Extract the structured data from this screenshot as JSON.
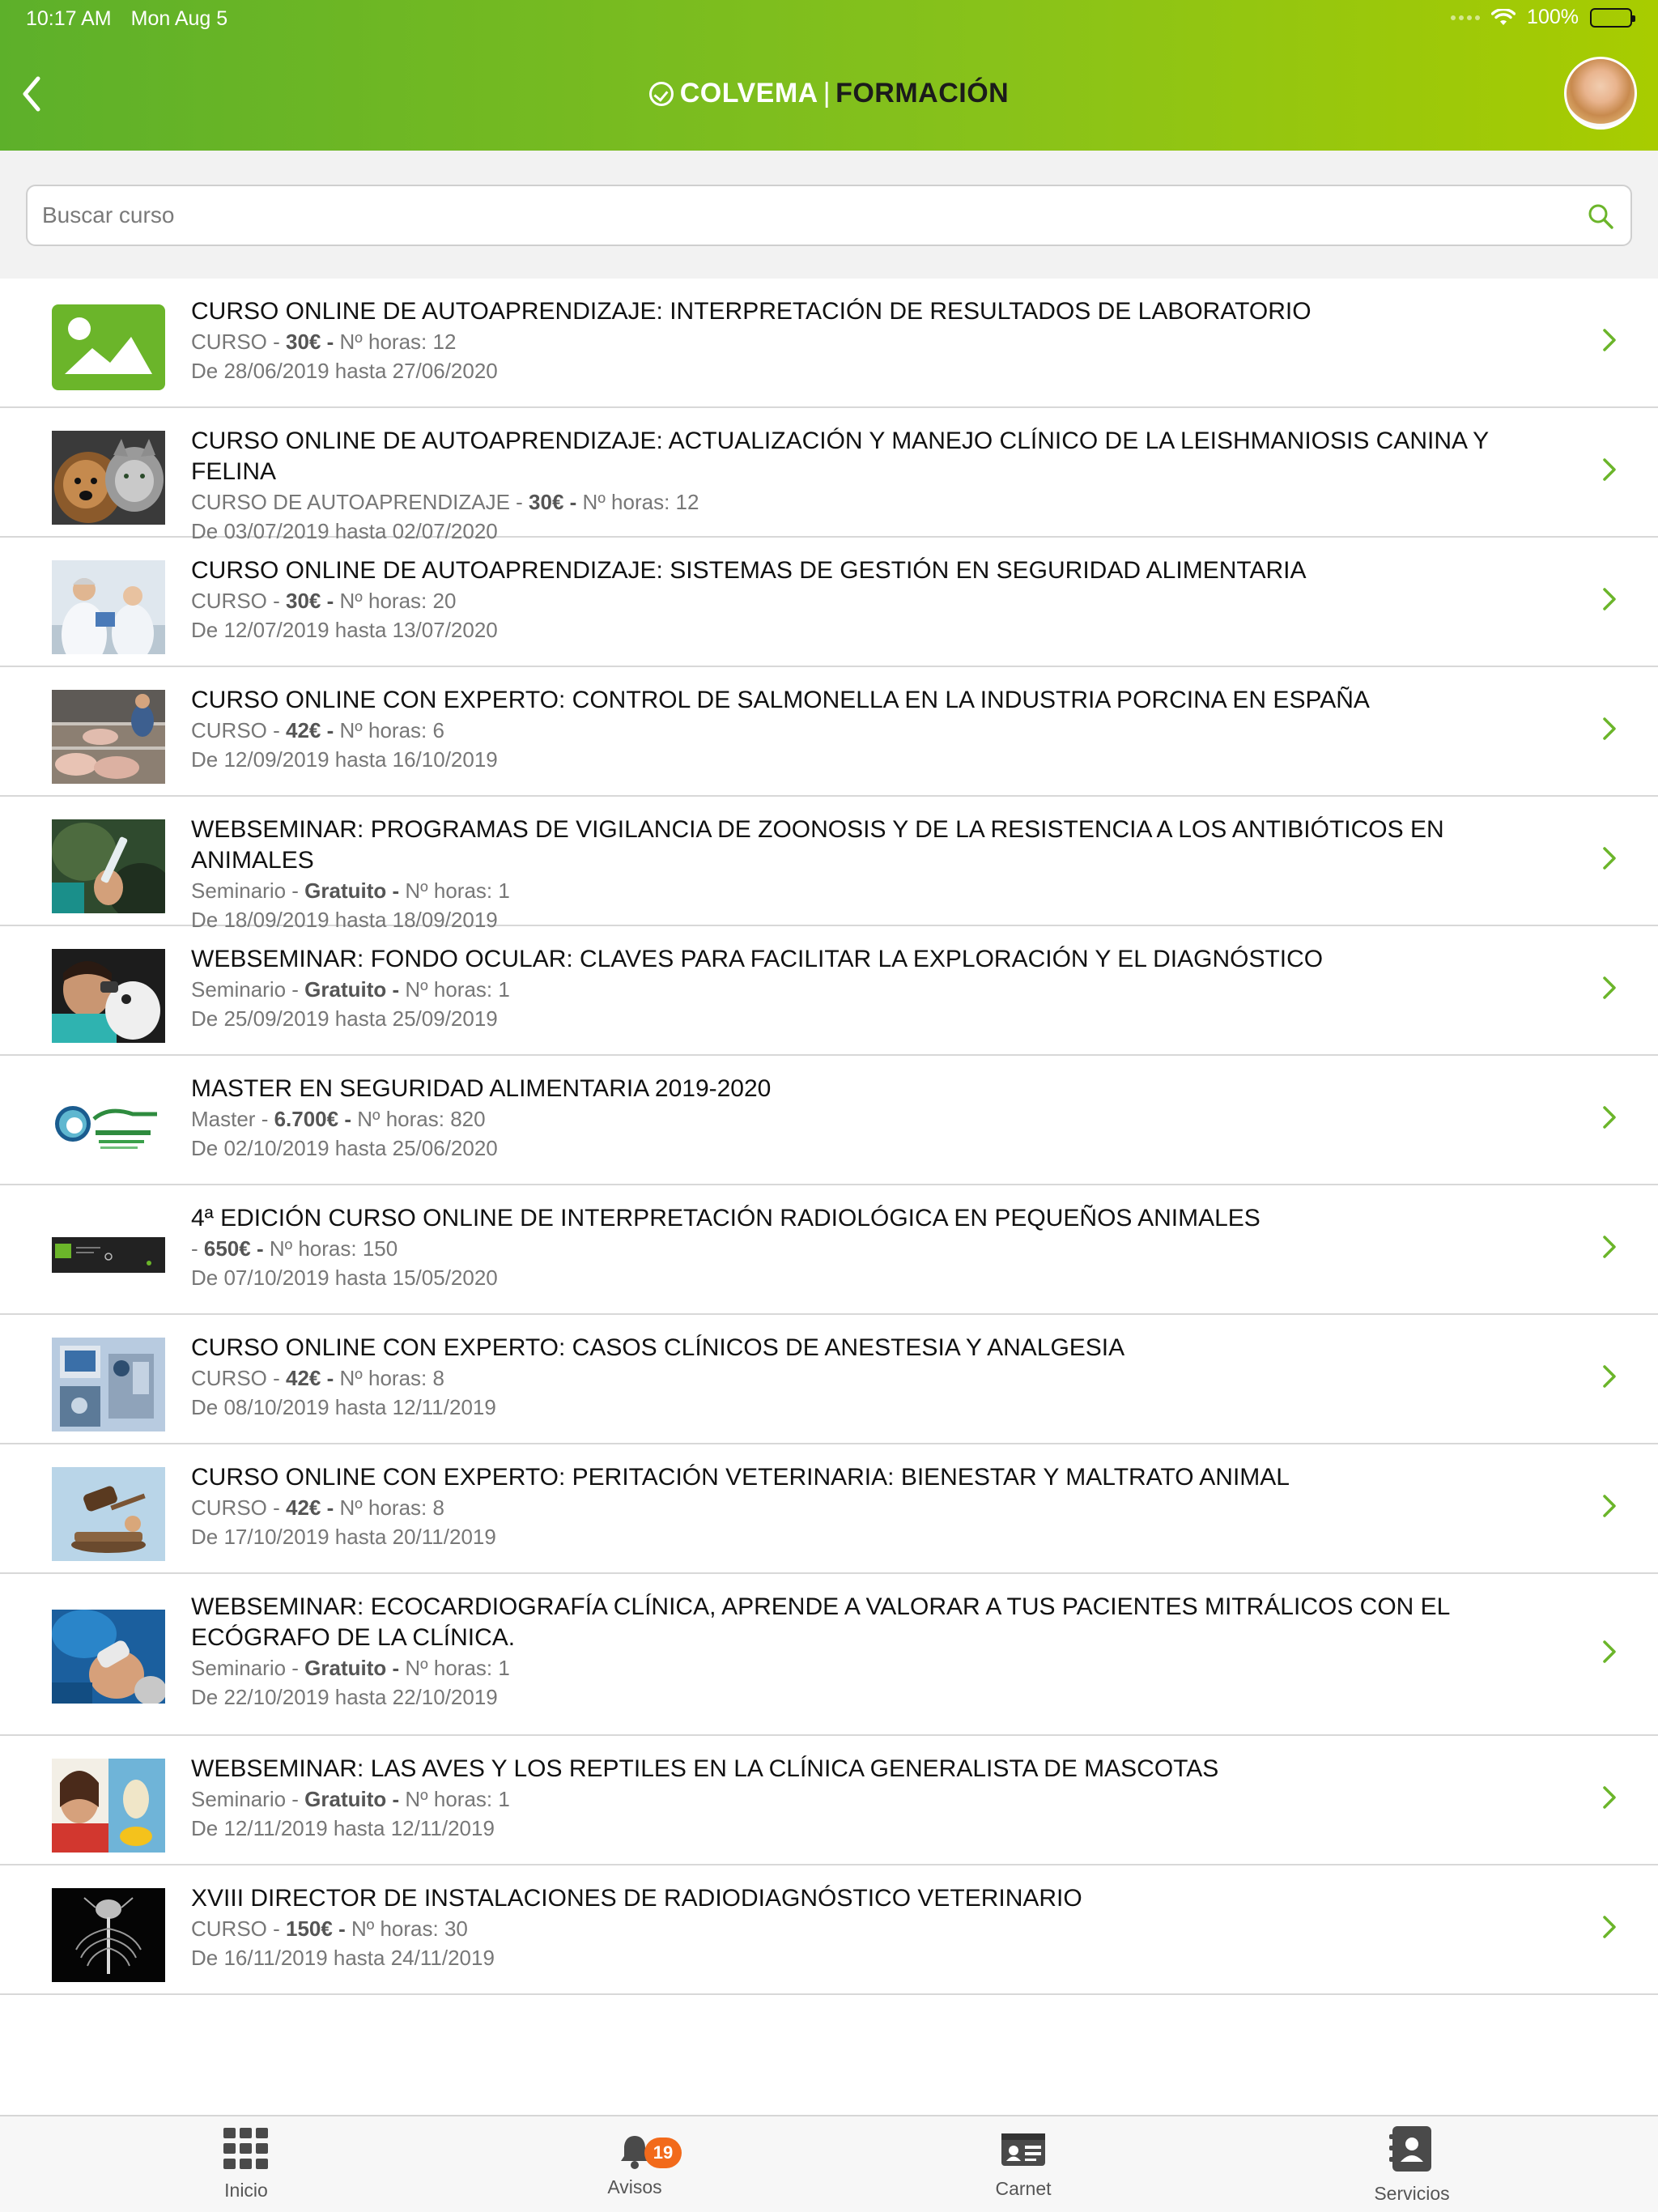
{
  "status_bar": {
    "time": "10:17 AM",
    "date": "Mon Aug 5",
    "battery": "100%"
  },
  "header": {
    "brand": "COLVEMA",
    "separator": "|",
    "subtitle": "FORMACIÓN",
    "brand_color": "#7cbb1f"
  },
  "search": {
    "placeholder": "Buscar curso",
    "value": ""
  },
  "courses": [
    {
      "title": "CURSO ONLINE DE AUTOAPRENDIZAJE: INTERPRETACIÓN DE RESULTADOS DE LABORATORIO",
      "type": "CURSO",
      "price": "30€",
      "hours_label": "Nº horas: 12",
      "dates": "De 28/06/2019 hasta 27/06/2020",
      "thumb": "placeholder-image-icon"
    },
    {
      "title": "CURSO ONLINE DE AUTOAPRENDIZAJE: ACTUALIZACIÓN Y MANEJO CLÍNICO DE LA LEISHMANIOSIS CANINA Y FELINA",
      "type": "CURSO DE AUTOAPRENDIZAJE",
      "price": "30€",
      "hours_label": "Nº horas: 12",
      "dates": "De 03/07/2019 hasta 02/07/2020",
      "thumb": "dog-and-cat-photo"
    },
    {
      "title": "CURSO ONLINE DE AUTOAPRENDIZAJE: SISTEMAS DE GESTIÓN EN SEGURIDAD ALIMENTARIA",
      "type": "CURSO",
      "price": "30€",
      "hours_label": "Nº horas: 20",
      "dates": "De 12/07/2019 hasta 13/07/2020",
      "thumb": "lab-workers-photo"
    },
    {
      "title": "CURSO ONLINE CON EXPERTO: CONTROL DE SALMONELLA EN LA INDUSTRIA PORCINA EN ESPAÑA",
      "type": "CURSO",
      "price": "42€",
      "hours_label": "Nº horas: 6",
      "dates": "De 12/09/2019 hasta 16/10/2019",
      "thumb": "pig-farm-photo"
    },
    {
      "title": "WEBSEMINAR: PROGRAMAS DE VIGILANCIA DE ZOONOSIS Y DE LA RESISTENCIA A LOS ANTIBIÓTICOS EN ANIMALES",
      "type": "Seminario",
      "price": "Gratuito",
      "hours_label": "Nº horas: 1",
      "dates": "De 18/09/2019 hasta 18/09/2019",
      "thumb": "syringe-photo"
    },
    {
      "title": "WEBSEMINAR: FONDO OCULAR: CLAVES PARA FACILITAR LA EXPLORACIÓN Y EL DIAGNÓSTICO",
      "type": "Seminario",
      "price": "Gratuito",
      "hours_label": "Nº horas: 1",
      "dates": "De 25/09/2019 hasta 25/09/2019",
      "thumb": "eye-exam-photo"
    },
    {
      "title": "MASTER EN SEGURIDAD ALIMENTARIA 2019-2020",
      "type": "Master",
      "price": "6.700€",
      "hours_label": "Nº horas: 820",
      "dates": "De 02/10/2019 hasta 25/06/2020",
      "thumb": "msa-logo"
    },
    {
      "title": "4ª EDICIÓN CURSO ONLINE DE INTERPRETACIÓN RADIOLÓGICA EN PEQUEÑOS ANIMALES",
      "type": "",
      "price": "650€",
      "hours_label": "Nº horas: 150",
      "dates": "De 07/10/2019 hasta 15/05/2020",
      "thumb": "radiology-banner"
    },
    {
      "title": "CURSO ONLINE CON EXPERTO: CASOS CLÍNICOS DE ANESTESIA Y ANALGESIA",
      "type": "CURSO",
      "price": "42€",
      "hours_label": "Nº horas: 8",
      "dates": "De 08/10/2019 hasta 12/11/2019",
      "thumb": "anesthesia-machine-photo"
    },
    {
      "title": "CURSO ONLINE CON EXPERTO: PERITACIÓN VETERINARIA: BIENESTAR Y MALTRATO ANIMAL",
      "type": "CURSO",
      "price": "42€",
      "hours_label": "Nº horas: 8",
      "dates": "De 17/10/2019 hasta 20/11/2019",
      "thumb": "gavel-photo"
    },
    {
      "title": "WEBSEMINAR: ECOCARDIOGRAFÍA CLÍNICA, APRENDE A VALORAR A TUS PACIENTES MITRÁLICOS CON EL ECÓGRAFO DE LA CLÍNICA.",
      "type": "Seminario",
      "price": "Gratuito",
      "hours_label": "Nº horas: 1",
      "dates": "De 22/10/2019 hasta 22/10/2019",
      "thumb": "ultrasound-photo"
    },
    {
      "title": "WEBSEMINAR: LAS AVES Y LOS REPTILES EN LA CLÍNICA GENERALISTA DE MASCOTAS",
      "type": "Seminario",
      "price": "Gratuito",
      "hours_label": "Nº horas: 1",
      "dates": "De 12/11/2019 hasta 12/11/2019",
      "thumb": "birds-reptiles-photo"
    },
    {
      "title": "XVIII DIRECTOR DE INSTALACIONES DE RADIODIAGNÓSTICO VETERINARIO",
      "type": "CURSO",
      "price": "150€",
      "hours_label": "Nº horas: 30",
      "dates": "De 16/11/2019 hasta 24/11/2019",
      "thumb": "xray-skeleton-photo"
    }
  ],
  "tabs": [
    {
      "label": "Inicio",
      "icon": "grid-icon"
    },
    {
      "label": "Avisos",
      "icon": "bell-icon",
      "badge": "19"
    },
    {
      "label": "Carnet",
      "icon": "id-card-icon"
    },
    {
      "label": "Servicios",
      "icon": "contacts-book-icon"
    }
  ]
}
